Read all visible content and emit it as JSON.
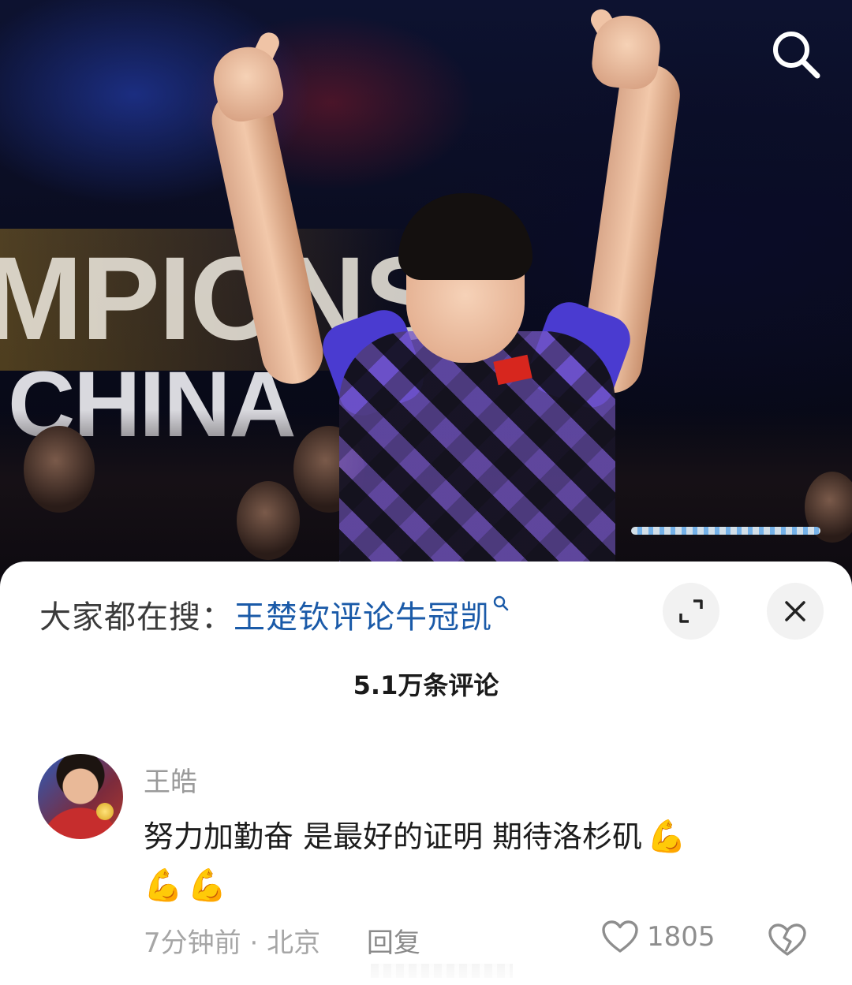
{
  "hero": {
    "background_words": [
      "MPIONS",
      "CHINA"
    ],
    "search_icon": "search-icon",
    "accent_colors": {
      "shirt_purple": "#4a3bd0",
      "flag_red": "#d7261e"
    }
  },
  "sheet": {
    "trending_label": "大家都在搜：",
    "trending_query": "王楚钦评论牛冠凯",
    "expand_icon": "expand-icon",
    "close_icon": "close-icon",
    "comment_count_title": "5.1万条评论"
  },
  "comment": {
    "username": "王皓",
    "text": "努力加勤奋 是最好的证明 期待洛杉矶",
    "emojis": [
      "💪",
      "💪",
      "💪"
    ],
    "time": "7分钟前",
    "separator": "·",
    "location": "北京",
    "reply_label": "回复",
    "like_icon": "heart-outline-icon",
    "like_count": "1805",
    "dislike_icon": "broken-heart-icon"
  },
  "colors": {
    "link_blue": "#1a5aa8",
    "muted_gray": "#9a9a9a",
    "sheet_bg": "#ffffff"
  }
}
